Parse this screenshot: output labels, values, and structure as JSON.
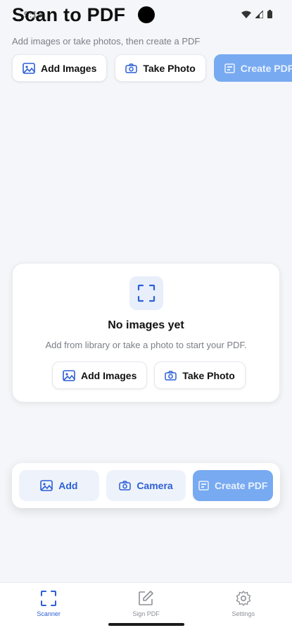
{
  "status_bar": {
    "time": "9:19"
  },
  "header": {
    "title": "Scan to PDF",
    "subtitle": "Add images or take photos, then create a PDF"
  },
  "top_actions": {
    "add_images": "Add Images",
    "take_photo": "Take Photo",
    "create_pdf": "Create PDF"
  },
  "empty_state": {
    "title": "No images yet",
    "text": "Add from library or take a photo to start your PDF.",
    "add_images": "Add Images",
    "take_photo": "Take Photo"
  },
  "toolbar": {
    "add": "Add",
    "camera": "Camera",
    "create_pdf": "Create PDF"
  },
  "nav": {
    "items": [
      {
        "label": "Scanner",
        "icon": "scan-frame-icon",
        "active": true
      },
      {
        "label": "Sign PDF",
        "icon": "edit-square-icon",
        "active": false
      },
      {
        "label": "Settings",
        "icon": "gear-icon",
        "active": false
      }
    ]
  },
  "colors": {
    "accent": "#2c5fd6",
    "primary_disabled": "#78aaf1",
    "background": "#f4f6f9",
    "muted_text": "#7b7f86"
  }
}
